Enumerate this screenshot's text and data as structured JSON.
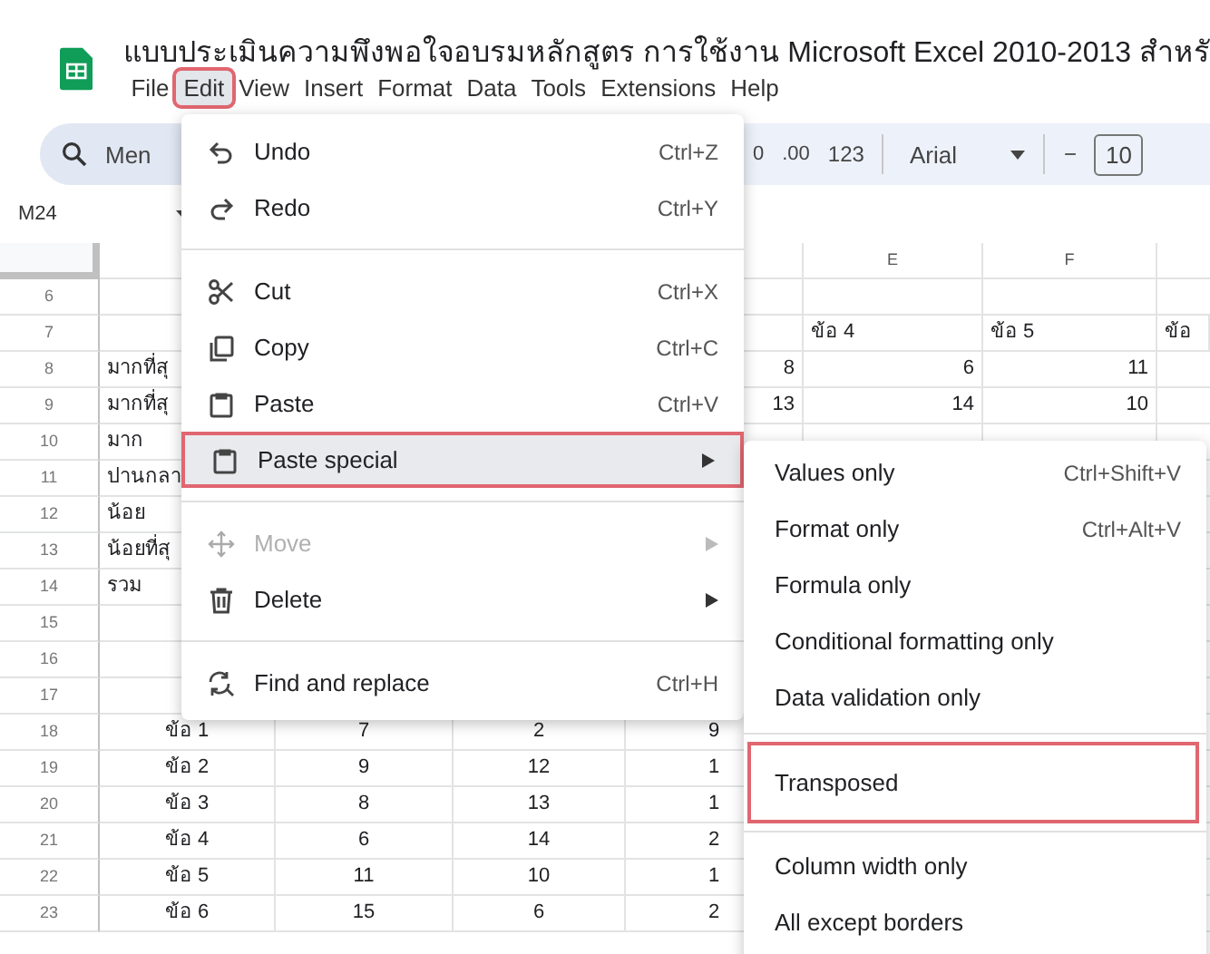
{
  "document": {
    "title": "แบบประเมินความพึงพอใจอบรมหลักสูตร การใช้งาน Microsoft Excel 2010-2013 สำหรั"
  },
  "menu_bar": [
    {
      "label": "File",
      "selected": false,
      "highlighted": false
    },
    {
      "label": "Edit",
      "selected": true,
      "highlighted": true
    },
    {
      "label": "View",
      "selected": false,
      "highlighted": false
    },
    {
      "label": "Insert",
      "selected": false,
      "highlighted": false
    },
    {
      "label": "Format",
      "selected": false,
      "highlighted": false
    },
    {
      "label": "Data",
      "selected": false,
      "highlighted": false
    },
    {
      "label": "Tools",
      "selected": false,
      "highlighted": false
    },
    {
      "label": "Extensions",
      "selected": false,
      "highlighted": false
    },
    {
      "label": "Help",
      "selected": false,
      "highlighted": false
    }
  ],
  "toolbar": {
    "search": {
      "placeholder": "Men"
    },
    "items": [
      {
        "kind": "decimal",
        "label": "0"
      },
      {
        "kind": "decimal",
        "label": ".00"
      },
      {
        "kind": "text",
        "label": "123"
      },
      {
        "kind": "divider"
      },
      {
        "kind": "dropdown",
        "label": "Arial"
      },
      {
        "kind": "divider"
      },
      {
        "kind": "text",
        "label": "−"
      },
      {
        "kind": "box",
        "label": "10"
      }
    ]
  },
  "name_box": {
    "value": "M24"
  },
  "sheet": {
    "columns": [
      {},
      {},
      {},
      {},
      {
        "label": "E"
      },
      {
        "label": "F"
      },
      {}
    ],
    "rows": [
      {
        "number": "6",
        "cells": {}
      },
      {
        "number": "7",
        "cells": {
          "column_5": "ข้อ 4",
          "column_6": "ข้อ 5",
          "column_7": "ข้อ"
        }
      },
      {
        "number": "8",
        "kind": "count",
        "cells": {
          "column_1": "มากที่สุ",
          "column_4": "8",
          "column_5": "6",
          "column_6": "11"
        }
      },
      {
        "number": "9",
        "kind": "count",
        "cells": {
          "column_1": "มากที่สุ",
          "column_4": "13",
          "column_5": "14",
          "column_6": "10"
        }
      },
      {
        "number": "10",
        "kind": "count",
        "cells": {
          "column_1": "มาก"
        }
      },
      {
        "number": "11",
        "kind": "count",
        "cells": {
          "column_1": "ปานกลา"
        }
      },
      {
        "number": "12",
        "kind": "count",
        "cells": {
          "column_1": "น้อย"
        }
      },
      {
        "number": "13",
        "kind": "count",
        "cells": {
          "column_1": "น้อยที่สุ"
        }
      },
      {
        "number": "14",
        "kind": "count",
        "cells": {
          "column_1": "รวม"
        }
      },
      {
        "number": "15",
        "cells": {}
      },
      {
        "number": "16",
        "cells": {}
      },
      {
        "number": "17",
        "cells": {}
      },
      {
        "number": "18",
        "kind": "table",
        "cells": {
          "column_1": "ข้อ 1",
          "column_2": "7",
          "column_3": "2",
          "column_4": "9"
        }
      },
      {
        "number": "19",
        "kind": "table",
        "cells": {
          "column_1": "ข้อ 2",
          "column_2": "9",
          "column_3": "12",
          "column_4": "1"
        }
      },
      {
        "number": "20",
        "kind": "table",
        "cells": {
          "column_1": "ข้อ 3",
          "column_2": "8",
          "column_3": "13",
          "column_4": "1"
        }
      },
      {
        "number": "21",
        "kind": "table",
        "cells": {
          "column_1": "ข้อ 4",
          "column_2": "6",
          "column_3": "14",
          "column_4": "2"
        }
      },
      {
        "number": "22",
        "kind": "table",
        "cells": {
          "column_1": "ข้อ 5",
          "column_2": "11",
          "column_3": "10",
          "column_4": "1"
        }
      },
      {
        "number": "23",
        "kind": "table",
        "cells": {
          "column_1": "ข้อ 6",
          "column_2": "15",
          "column_3": "6",
          "column_4": "2"
        }
      }
    ]
  },
  "edit_menu": {
    "items": [
      {
        "kind": "undo",
        "label": "Undo",
        "shortcut": "Ctrl+Z",
        "disabled": false,
        "selected": false,
        "highlighted": false,
        "submenu": false
      },
      {
        "kind": "redo",
        "label": "Redo",
        "shortcut": "Ctrl+Y",
        "disabled": false,
        "selected": false,
        "highlighted": false,
        "submenu": false
      },
      {
        "kind": "divider"
      },
      {
        "kind": "cut",
        "label": "Cut",
        "shortcut": "Ctrl+X",
        "disabled": false,
        "selected": false,
        "highlighted": false,
        "submenu": false
      },
      {
        "kind": "copy",
        "label": "Copy",
        "shortcut": "Ctrl+C",
        "disabled": false,
        "selected": false,
        "highlighted": false,
        "submenu": false
      },
      {
        "kind": "paste",
        "label": "Paste",
        "shortcut": "Ctrl+V",
        "disabled": false,
        "selected": false,
        "highlighted": false,
        "submenu": false
      },
      {
        "kind": "paste",
        "label": "Paste special",
        "disabled": false,
        "selected": true,
        "highlighted": true,
        "submenu": true
      },
      {
        "kind": "divider"
      },
      {
        "kind": "move",
        "label": "Move",
        "disabled": true,
        "selected": false,
        "highlighted": false,
        "submenu": true
      },
      {
        "kind": "delete",
        "label": "Delete",
        "disabled": false,
        "selected": false,
        "highlighted": false,
        "submenu": true
      },
      {
        "kind": "divider"
      },
      {
        "kind": "find",
        "label": "Find and replace",
        "shortcut": "Ctrl+H",
        "disabled": false,
        "selected": false,
        "highlighted": false,
        "submenu": false
      }
    ]
  },
  "paste_special_menu": {
    "items": [
      {
        "kind": "item",
        "label": "Values only",
        "shortcut": "Ctrl+Shift+V",
        "highlighted": false
      },
      {
        "kind": "item",
        "label": "Format only",
        "shortcut": "Ctrl+Alt+V",
        "highlighted": false
      },
      {
        "kind": "item",
        "label": "Formula only",
        "highlighted": false
      },
      {
        "kind": "item",
        "label": "Conditional formatting only",
        "highlighted": false
      },
      {
        "kind": "item",
        "label": "Data validation only",
        "highlighted": false
      },
      {
        "kind": "divider"
      },
      {
        "kind": "item",
        "label": "Transposed",
        "highlighted": true
      },
      {
        "kind": "divider"
      },
      {
        "kind": "item",
        "label": "Column width only",
        "highlighted": false
      },
      {
        "kind": "item",
        "label": "All except borders",
        "highlighted": false
      }
    ]
  }
}
